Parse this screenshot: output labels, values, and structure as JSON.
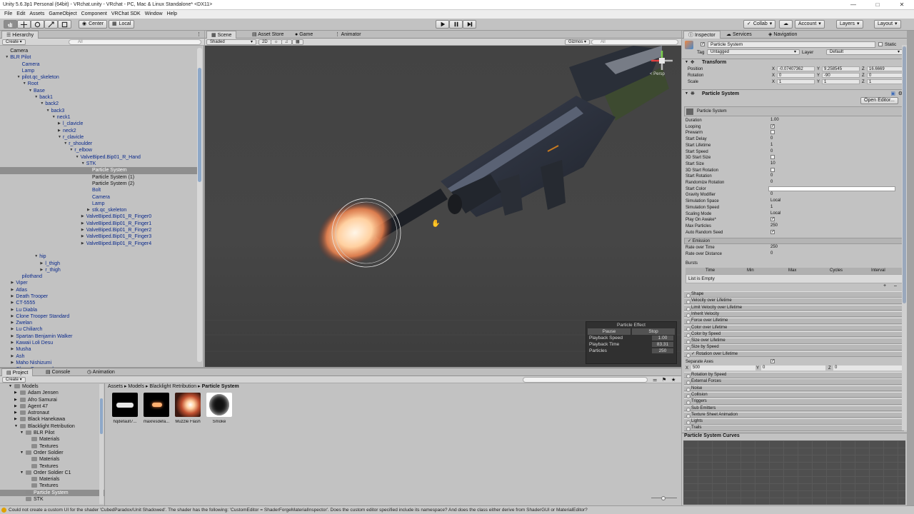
{
  "window": {
    "title": "Unity 5.6.3p1 Personal (64bit) - VRchat.unity - VRchat - PC, Mac & Linux Standalone* <DX11>"
  },
  "menu": [
    "File",
    "Edit",
    "Assets",
    "GameObject",
    "Component",
    "VRChat SDK",
    "Window",
    "Help"
  ],
  "toolbar": {
    "center": "Center",
    "local": "Local",
    "collab": "Collab",
    "account": "Account",
    "layers": "Layers",
    "layout": "Layout"
  },
  "hierarchy": {
    "tab": "Hierarchy",
    "create": "Create",
    "search": "All",
    "items": [
      {
        "label": "Camera",
        "depth": 1,
        "arrow": "",
        "blk": true
      },
      {
        "label": "BLR Pilot",
        "depth": 1,
        "arrow": "down"
      },
      {
        "label": "Camera",
        "depth": 3,
        "arrow": ""
      },
      {
        "label": "Lamp",
        "depth": 3,
        "arrow": ""
      },
      {
        "label": "pilot.qc_skeleton",
        "depth": 3,
        "arrow": "down"
      },
      {
        "label": "Root",
        "depth": 4,
        "arrow": "down"
      },
      {
        "label": "Base",
        "depth": 5,
        "arrow": "down"
      },
      {
        "label": "back1",
        "depth": 6,
        "arrow": "down"
      },
      {
        "label": "back2",
        "depth": 7,
        "arrow": "down"
      },
      {
        "label": "back3",
        "depth": 8,
        "arrow": "down"
      },
      {
        "label": "neck1",
        "depth": 9,
        "arrow": "down"
      },
      {
        "label": "l_clavicle",
        "depth": 10,
        "arrow": "right"
      },
      {
        "label": "neck2",
        "depth": 10,
        "arrow": "right"
      },
      {
        "label": "r_clavicle",
        "depth": 10,
        "arrow": "down"
      },
      {
        "label": "r_shoulder",
        "depth": 11,
        "arrow": "down"
      },
      {
        "label": "r_elbow",
        "depth": 12,
        "arrow": "down"
      },
      {
        "label": "ValveBiped.Bip01_R_Hand",
        "depth": 13,
        "arrow": "down"
      },
      {
        "label": "STK",
        "depth": 14,
        "arrow": "down"
      },
      {
        "label": "Particle System",
        "depth": 15,
        "arrow": "",
        "sel": true
      },
      {
        "label": "Particle System (1)",
        "depth": 15,
        "arrow": "",
        "blk": true
      },
      {
        "label": "Particle System (2)",
        "depth": 15,
        "arrow": "",
        "blk": true
      },
      {
        "label": "Bolt",
        "depth": 15,
        "arrow": ""
      },
      {
        "label": "Camera",
        "depth": 15,
        "arrow": ""
      },
      {
        "label": "Lamp",
        "depth": 15,
        "arrow": ""
      },
      {
        "label": "stk.qc_skeleton",
        "depth": 15,
        "arrow": "right"
      },
      {
        "label": "ValveBiped.Bip01_R_Finger0",
        "depth": 14,
        "arrow": "right"
      },
      {
        "label": "ValveBiped.Bip01_R_Finger1",
        "depth": 14,
        "arrow": "right"
      },
      {
        "label": "ValveBiped.Bip01_R_Finger2",
        "depth": 14,
        "arrow": "right"
      },
      {
        "label": "ValveBiped.Bip01_R_Finger3",
        "depth": 14,
        "arrow": "right"
      },
      {
        "label": "ValveBiped.Bip01_R_Finger4",
        "depth": 14,
        "arrow": "right"
      },
      {
        "label": "",
        "depth": 0,
        "arrow": ""
      },
      {
        "label": "hip",
        "depth": 6,
        "arrow": "down"
      },
      {
        "label": "l_thigh",
        "depth": 7,
        "arrow": "right"
      },
      {
        "label": "r_thigh",
        "depth": 7,
        "arrow": "right"
      },
      {
        "label": "pilothand",
        "depth": 3,
        "arrow": ""
      },
      {
        "label": "Viper",
        "depth": 2,
        "arrow": "right"
      },
      {
        "label": "Atlas",
        "depth": 2,
        "arrow": "right"
      },
      {
        "label": "Death Trooper",
        "depth": 2,
        "arrow": "right"
      },
      {
        "label": "CT-5555",
        "depth": 2,
        "arrow": "right"
      },
      {
        "label": "Lu Diabla",
        "depth": 2,
        "arrow": "right"
      },
      {
        "label": "Clone Trooper Standard",
        "depth": 2,
        "arrow": "right"
      },
      {
        "label": "Zwelan",
        "depth": 2,
        "arrow": "right"
      },
      {
        "label": "Lu Chiliarch",
        "depth": 2,
        "arrow": "right"
      },
      {
        "label": "Spartan Benjamin Walker",
        "depth": 2,
        "arrow": "right"
      },
      {
        "label": "Kawaii Loli Desu",
        "depth": 2,
        "arrow": "right"
      },
      {
        "label": "Musha",
        "depth": 2,
        "arrow": "right"
      },
      {
        "label": "Ash",
        "depth": 2,
        "arrow": "right"
      },
      {
        "label": "Maho Nishizumi",
        "depth": 2,
        "arrow": "right"
      },
      {
        "label": "Clone Commando",
        "depth": 2,
        "arrow": "right"
      }
    ]
  },
  "scene": {
    "tabs": [
      "Scene",
      "Asset Store",
      "Game",
      "Animator"
    ],
    "shading": "Shaded",
    "mode2d": "2D",
    "gizmos": "Gizmos",
    "search": "All",
    "persp": "< Persp"
  },
  "particle_effect": {
    "title": "Particle Effect",
    "pause": "Pause",
    "stop": "Stop",
    "rows": [
      {
        "label": "Playback Speed",
        "value": "1.00"
      },
      {
        "label": "Playback Time",
        "value": "83.31"
      },
      {
        "label": "Particles",
        "value": "250"
      }
    ]
  },
  "inspector": {
    "tabs": [
      "Inspector",
      "Services",
      "Navigation"
    ],
    "object_name": "Particle System",
    "static_label": "Static",
    "tag_label": "Tag",
    "tag_value": "Untagged",
    "layer_label": "Layer",
    "layer_value": "Default",
    "transform": {
      "title": "Transform",
      "position": {
        "label": "Position",
        "x": "-0.07407362",
        "y": "9.258545",
        "z": "16.6669"
      },
      "rotation": {
        "label": "Rotation",
        "x": "0",
        "y": "-90",
        "z": "0"
      },
      "scale": {
        "label": "Scale",
        "x": "1",
        "y": "1",
        "z": "1"
      }
    },
    "ps_title": "Particle System",
    "open_editor": "Open Editor...",
    "ps_subheader": "Particle System",
    "props": [
      {
        "k": "Duration",
        "v": "1.00"
      },
      {
        "k": "Looping",
        "v": "✓",
        "chk": true
      },
      {
        "k": "Prewarm",
        "v": "",
        "chk": true
      },
      {
        "k": "Start Delay",
        "v": "0"
      },
      {
        "k": "Start Lifetime",
        "v": "1"
      },
      {
        "k": "Start Speed",
        "v": "0"
      },
      {
        "k": "3D Start Size",
        "v": "",
        "chk": true
      },
      {
        "k": "Start Size",
        "v": "10"
      },
      {
        "k": "3D Start Rotation",
        "v": "",
        "chk": true
      },
      {
        "k": "Start Rotation",
        "v": "0"
      },
      {
        "k": "Randomize Rotation",
        "v": "0"
      },
      {
        "k": "Start Color",
        "v": "",
        "color": true
      },
      {
        "k": "Gravity Modifier",
        "v": "0"
      },
      {
        "k": "Simulation Space",
        "v": "Local"
      },
      {
        "k": "Simulation Speed",
        "v": "1"
      },
      {
        "k": "Scaling Mode",
        "v": "Local"
      },
      {
        "k": "Play On Awake*",
        "v": "✓",
        "chk": true
      },
      {
        "k": "Max Particles",
        "v": "250"
      },
      {
        "k": "Auto Random Seed",
        "v": "✓",
        "chk": true
      }
    ],
    "emission": {
      "title": "✓ Emission",
      "rate_time": {
        "k": "Rate over Time",
        "v": "250"
      },
      "rate_dist": {
        "k": "Rate over Distance",
        "v": "0"
      },
      "bursts": "Bursts",
      "cols": [
        "Time",
        "Min",
        "Max",
        "Cycles",
        "Interval"
      ],
      "empty": "List is Empty"
    },
    "modules": [
      "Shape",
      "Velocity over Lifetime",
      "Limit Velocity over Lifetime",
      "Inherit Velocity",
      "Force over Lifetime",
      "Color over Lifetime",
      "Color by Speed",
      "Size over Lifetime",
      "Size by Speed",
      "✓ Rotation over Lifetime"
    ],
    "separate_axes": "Separate Axes",
    "x_label": "X",
    "x_value": "500",
    "y_label": "Y",
    "y_value": "0",
    "z_label": "Z",
    "z_value": "0",
    "modules2": [
      "Rotation by Speed",
      "External Forces",
      "Noise",
      "Collision",
      "Triggers",
      "Sub Emitters",
      "Texture Sheet Animation",
      "Lights",
      "Trails"
    ],
    "curves_title": "Particle System Curves"
  },
  "project": {
    "tabs": [
      "Project",
      "Console",
      "Animation"
    ],
    "create": "Create",
    "breadcrumb": [
      "Assets",
      "Models",
      "Blacklight Retribution",
      "Particle System"
    ],
    "folders": [
      {
        "label": "Models",
        "depth": 1,
        "arrow": "down"
      },
      {
        "label": "Adam Jensen",
        "depth": 2,
        "arrow": "right"
      },
      {
        "label": "Afro Samurai",
        "depth": 2,
        "arrow": "right"
      },
      {
        "label": "Agent 47",
        "depth": 2,
        "arrow": "right"
      },
      {
        "label": "Astronaut",
        "depth": 2,
        "arrow": "right"
      },
      {
        "label": "Black Hanekawa",
        "depth": 2,
        "arrow": "right"
      },
      {
        "label": "Blacklight Retribution",
        "depth": 2,
        "arrow": "down"
      },
      {
        "label": "BLR Pilot",
        "depth": 3,
        "arrow": "down"
      },
      {
        "label": "Materials",
        "depth": 4,
        "arrow": ""
      },
      {
        "label": "Textures",
        "depth": 4,
        "arrow": ""
      },
      {
        "label": "Order Soldier",
        "depth": 3,
        "arrow": "down"
      },
      {
        "label": "Materials",
        "depth": 4,
        "arrow": ""
      },
      {
        "label": "Textures",
        "depth": 4,
        "arrow": ""
      },
      {
        "label": "Order Soldier C1",
        "depth": 3,
        "arrow": "down"
      },
      {
        "label": "Materials",
        "depth": 4,
        "arrow": ""
      },
      {
        "label": "Textures",
        "depth": 4,
        "arrow": ""
      },
      {
        "label": "Particle System",
        "depth": 3,
        "arrow": "",
        "sel": true
      },
      {
        "label": "STK",
        "depth": 3,
        "arrow": ""
      }
    ],
    "assets": [
      {
        "label": "hqdefault7..."
      },
      {
        "label": "maxresdefa..."
      },
      {
        "label": "Muzzle Flash"
      },
      {
        "label": "Smoke"
      }
    ]
  },
  "status": {
    "message": "Could not create a custom UI for the shader 'CubedParadox/Unit Shadowed'. The shader has the following: 'CustomEditor = ShaderForgeMaterialInspector'. Does the custom editor specified include its namespace? And does the class either derive from ShaderGUI or MaterialEditor?"
  }
}
